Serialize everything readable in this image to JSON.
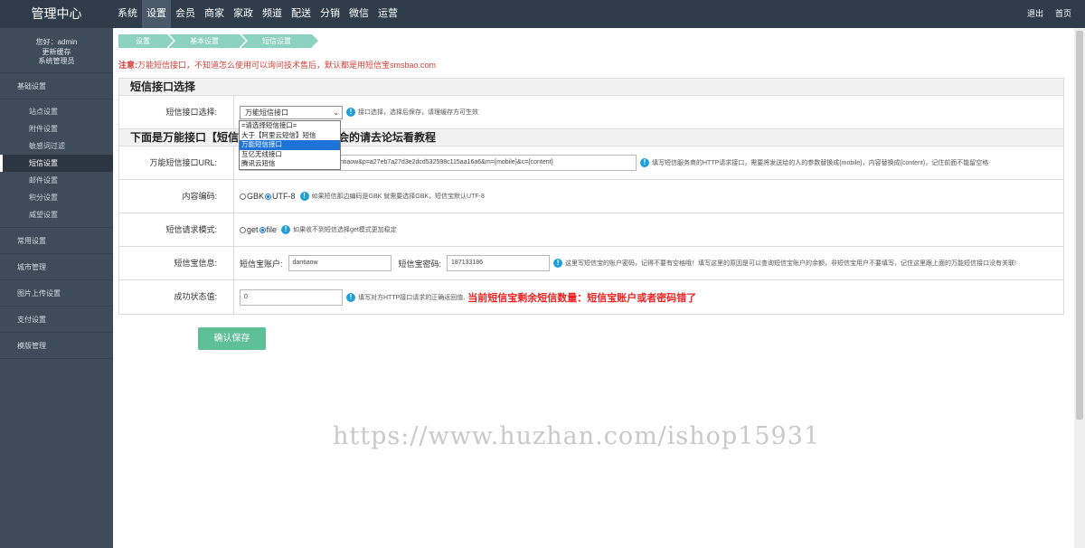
{
  "brand": "管理中心",
  "topnav": [
    "系统",
    "设置",
    "会员",
    "商家",
    "家政",
    "频道",
    "配送",
    "分销",
    "微信",
    "运营"
  ],
  "topnav_active_index": 1,
  "topright": {
    "logout": "退出",
    "home": "首页"
  },
  "user": {
    "greeting": "您好：admin",
    "refresh": "更新缓存",
    "role": "系统管理员"
  },
  "sidebar": {
    "group_basic": "基础设置",
    "sub_items": [
      "站点设置",
      "附件设置",
      "敏感词过滤",
      "短信设置",
      "邮件设置",
      "积分设置",
      "威望设置"
    ],
    "active_sub": "短信设置",
    "groups_after": [
      "常用设置",
      "城市管理",
      "图片上传设置",
      "支付设置",
      "模版管理"
    ]
  },
  "breadcrumbs": [
    "设置",
    "基本设置",
    "短信设置"
  ],
  "notice": {
    "prefix": "注意:",
    "text": "万能短信接口，不知道怎么使用可以询问技术售后，默认都是用短信宝smsbao.com"
  },
  "section1": {
    "title": "短信接口选择",
    "label": "短信接口选择:",
    "selected": "万能短信接口",
    "hint": "接口选择，选择后保存，请理缓存方可生效",
    "options": [
      "=请选择短信接口=",
      "大于【阿里云短信】短信",
      "万能短信接口",
      "互亿无线接口",
      "腾讯云短信"
    ],
    "highlighted_option": "万能短信接口"
  },
  "section2": {
    "title_left": "下面是万能接口【短信宝",
    "title_right": "会的请去论坛看教程",
    "url": {
      "label": "万能短信接口URL:",
      "value": "ntiaow&p=a27eb7a27d3e2dcd532598c115aa16a6&m={mobile}&c={content}",
      "hint": "填写短信服务商的HTTP请求接口，需要将发送给的人的参数替换成{mobile}，内容替换成{content}，记住前面不能留空格"
    },
    "encoding": {
      "label": "内容编码:",
      "options": [
        "GBK",
        "UTF-8"
      ],
      "selected": "UTF-8",
      "hint": "如果短信那边编码是GBK 就需要选择GBK，短信宝默认UTF-8"
    },
    "mode": {
      "label": "短信请求模式:",
      "options": [
        "get",
        "file"
      ],
      "selected": "file",
      "hint": "如果收不到短信选择get模式更加稳定"
    },
    "smsbao": {
      "label": "短信宝信息:",
      "account_label": "短信宝账户:",
      "account_value": "dantiaow",
      "password_label": "短信宝密码:",
      "password_value": "187133186",
      "hint": "这里写短信宝的账户密码，记得不要有空格哦！填写这里的原因是可以查询短信宝账户的余额，非短信宝用户不要填写，记住这里跟上面的万能短信接口没有关联!"
    },
    "status": {
      "label": "成功状态值:",
      "value": "0",
      "hint": "填写对方HTTP接口请求的正确返回值,",
      "warning": "当前短信宝剩余短信数量：短信宝账户或者密码错了"
    }
  },
  "save_button": "确认保存",
  "watermark": "https://www.huzhan.com/ishop15931"
}
